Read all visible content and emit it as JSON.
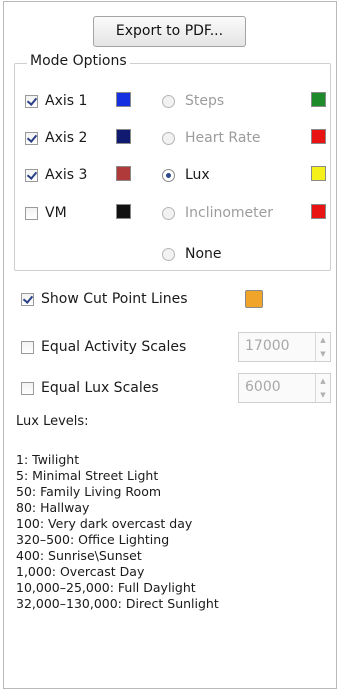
{
  "export_button": {
    "label": "Export to PDF..."
  },
  "mode_options": {
    "title": "Mode Options",
    "axes": [
      {
        "label": "Axis 1",
        "checked": true,
        "color": "#1530e0"
      },
      {
        "label": "Axis 2",
        "checked": true,
        "color": "#101a70"
      },
      {
        "label": "Axis 3",
        "checked": true,
        "color": "#b03a3a"
      },
      {
        "label": "VM",
        "checked": false,
        "color": "#111111"
      }
    ],
    "modes": [
      {
        "label": "Steps",
        "selected": false,
        "enabled": false,
        "color": "#1f8a2a"
      },
      {
        "label": "Heart Rate",
        "selected": false,
        "enabled": false,
        "color": "#e81414"
      },
      {
        "label": "Lux",
        "selected": true,
        "enabled": true,
        "color": "#f5f01a"
      },
      {
        "label": "Inclinometer",
        "selected": false,
        "enabled": false,
        "color": "#e81414"
      },
      {
        "label": "None",
        "selected": false,
        "enabled": true
      }
    ]
  },
  "show_cut_point_lines": {
    "label": "Show Cut Point Lines",
    "checked": true,
    "color": "#f0a52a"
  },
  "equal_activity_scales": {
    "label": "Equal Activity Scales",
    "checked": false,
    "value": "17000"
  },
  "equal_lux_scales": {
    "label": "Equal Lux Scales",
    "checked": false,
    "value": "6000"
  },
  "lux_levels": {
    "title": "Lux Levels:",
    "items": [
      "1: Twilight",
      "5: Minimal Street Light",
      "50: Family Living Room",
      "80: Hallway",
      "100: Very dark overcast day",
      "320–500: Office Lighting",
      "400: Sunrise\\Sunset",
      "1,000: Overcast Day",
      "10,000–25,000: Full Daylight",
      "32,000–130,000: Direct Sunlight"
    ]
  }
}
